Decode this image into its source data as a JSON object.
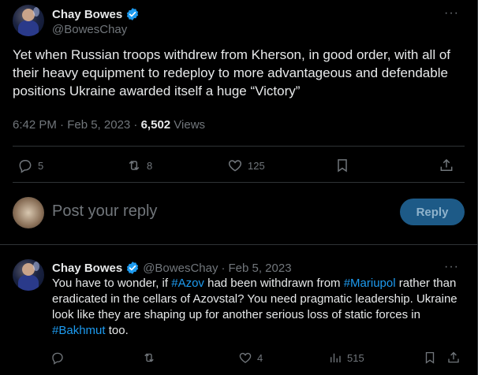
{
  "main_tweet": {
    "author_name": "Chay Bowes",
    "author_handle": "@BowesChay",
    "text": "Yet when Russian troops withdrew from Kherson, in good order, with all of their heavy equipment to redeploy to more advantageous and defendable positions Ukraine awarded itself a huge “Victory”",
    "timestamp": "6:42 PM · Feb 5, 2023 · ",
    "views_count": "6,502",
    "views_label": " Views",
    "actions": {
      "replies": "5",
      "retweets": "8",
      "likes": "125"
    },
    "more_label": "···"
  },
  "composer": {
    "placeholder": "Post your reply",
    "button_label": "Reply"
  },
  "reply_tweet": {
    "author_name": "Chay Bowes",
    "author_handle": "@BowesChay",
    "dot": "·",
    "date": "Feb 5, 2023",
    "more_label": "···",
    "text_parts": [
      {
        "t": "You have to wonder, if ",
        "tag": false
      },
      {
        "t": "#Azov",
        "tag": true
      },
      {
        "t": " had been withdrawn from ",
        "tag": false
      },
      {
        "t": "#Mariupol",
        "tag": true
      },
      {
        "t": " rather than eradicated in the cellars of Azovstal? You need pragmatic leadership. Ukraine look like they are shaping up for another serious loss of static forces in ",
        "tag": false
      },
      {
        "t": "#Bakhmut",
        "tag": true
      },
      {
        "t": " too.",
        "tag": false
      }
    ],
    "actions": {
      "replies": "",
      "retweets": "",
      "likes": "4",
      "views": "515"
    }
  },
  "colors": {
    "background": "#000000",
    "text": "#e7e9ea",
    "muted": "#71767b",
    "accent": "#1d9bf0",
    "divider": "#2f3336"
  }
}
